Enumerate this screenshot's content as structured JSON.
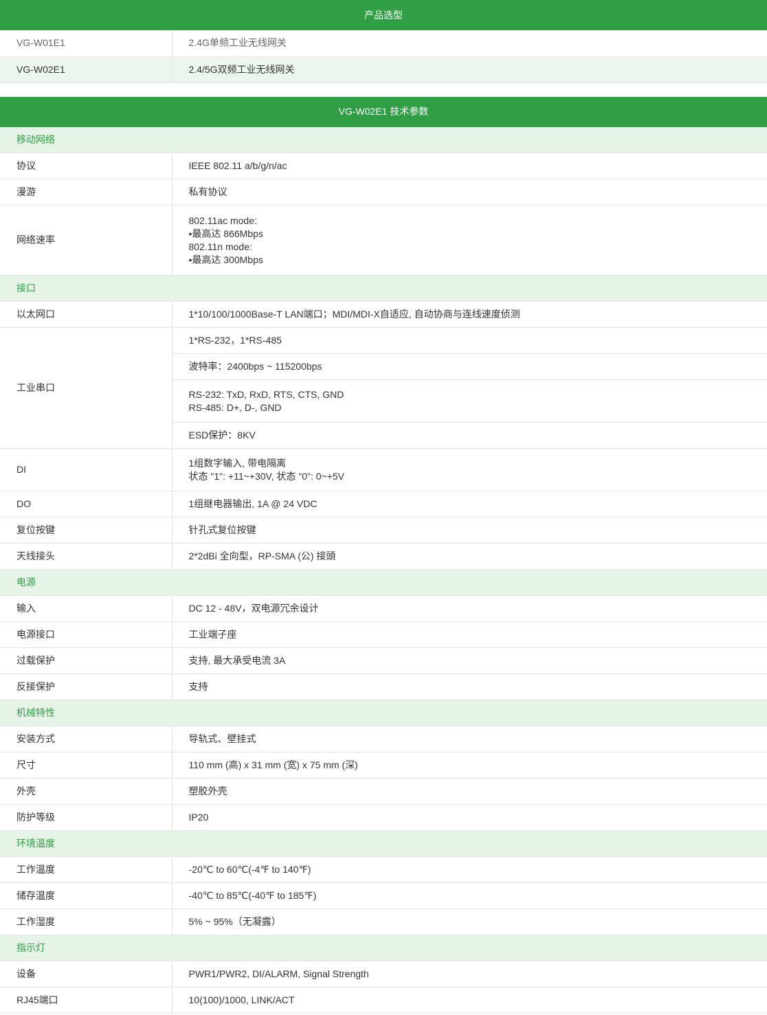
{
  "selection": {
    "title": "产品选型",
    "rows": [
      {
        "model": "VG-W01E1",
        "desc": "2.4G单频工业无线网关"
      },
      {
        "model": "VG-W02E1",
        "desc": "2.4/5G双频工业无线网关"
      }
    ]
  },
  "specs": {
    "title": "VG-W02E1 技术参数",
    "mobile": {
      "section": "移动网络",
      "protocol_label": "协议",
      "protocol_value": "IEEE 802.11 a/b/g/n/ac",
      "roaming_label": "漫游",
      "roaming_value": "私有协议",
      "rate_label": "网络速率",
      "rate_lines": [
        "802.11ac mode:",
        "•最高达 866Mbps",
        "802.11n mode:",
        "•最高达 300Mbps"
      ]
    },
    "interface": {
      "section": "接口",
      "ethernet_label": "以太网口",
      "ethernet_value": "1*10/100/1000Base-T LAN端口；MDI/MDI-X自适应, 自动协商与连线速度侦测",
      "serial_label": "工业串口",
      "serial_ports": "1*RS-232，1*RS-485",
      "serial_baud": "波特率：2400bps ~ 115200bps",
      "serial_signals": [
        "RS-232: TxD, RxD, RTS, CTS, GND",
        "RS-485: D+, D-, GND"
      ],
      "serial_esd": "ESD保护：8KV",
      "di_label": "DI",
      "di_lines": [
        "1组数字输入, 带电隔离",
        "状态 \"1\": +11~+30V, 状态 \"0\": 0~+5V"
      ],
      "do_label": "DO",
      "do_value": "1组继电器输出, 1A @ 24 VDC",
      "reset_label": "复位按键",
      "reset_value": "针孔式复位按键",
      "antenna_label": "天线接头",
      "antenna_value": "2*2dBi 全向型，RP-SMA (公) 接頭"
    },
    "power": {
      "section": "电源",
      "input_label": "输入",
      "input_value": "DC 12 - 48V，双电源冗余设计",
      "connector_label": "电源接口",
      "connector_value": "工业端子座",
      "overload_label": "过载保护",
      "overload_value": "支持, 最大承受电流 3A",
      "reverse_label": "反接保护",
      "reverse_value": "支持"
    },
    "mechanical": {
      "section": "机械特性",
      "mount_label": "安装方式",
      "mount_value": "导轨式、壁挂式",
      "size_label": "尺寸",
      "size_value": "110 mm (高) x 31 mm (宽) x 75 mm (深)",
      "case_label": "外壳",
      "case_value": "塑胶外壳",
      "ip_label": "防护等级",
      "ip_value": "IP20"
    },
    "environment": {
      "section": "环境温度",
      "op_temp_label": "工作温度",
      "op_temp_value": "-20℃ to 60℃(-4℉ to 140℉)",
      "storage_temp_label": "储存温度",
      "storage_temp_value": "-40℃ to 85℃(-40℉ to 185℉)",
      "humidity_label": "工作湿度",
      "humidity_value": "5% ~ 95%（无凝露）"
    },
    "indicator": {
      "section": "指示灯",
      "device_label": "设备",
      "device_value": "PWR1/PWR2, DI/ALARM, Signal Strength",
      "rj45_label": "RJ45端口",
      "rj45_value": "10(100)/1000, LINK/ACT"
    }
  },
  "colors": {
    "accent": "#2f9e44",
    "section_bg": "#e6f4e8",
    "row_alt_bg": "#eef7ef",
    "border": "#e4e4e4"
  }
}
